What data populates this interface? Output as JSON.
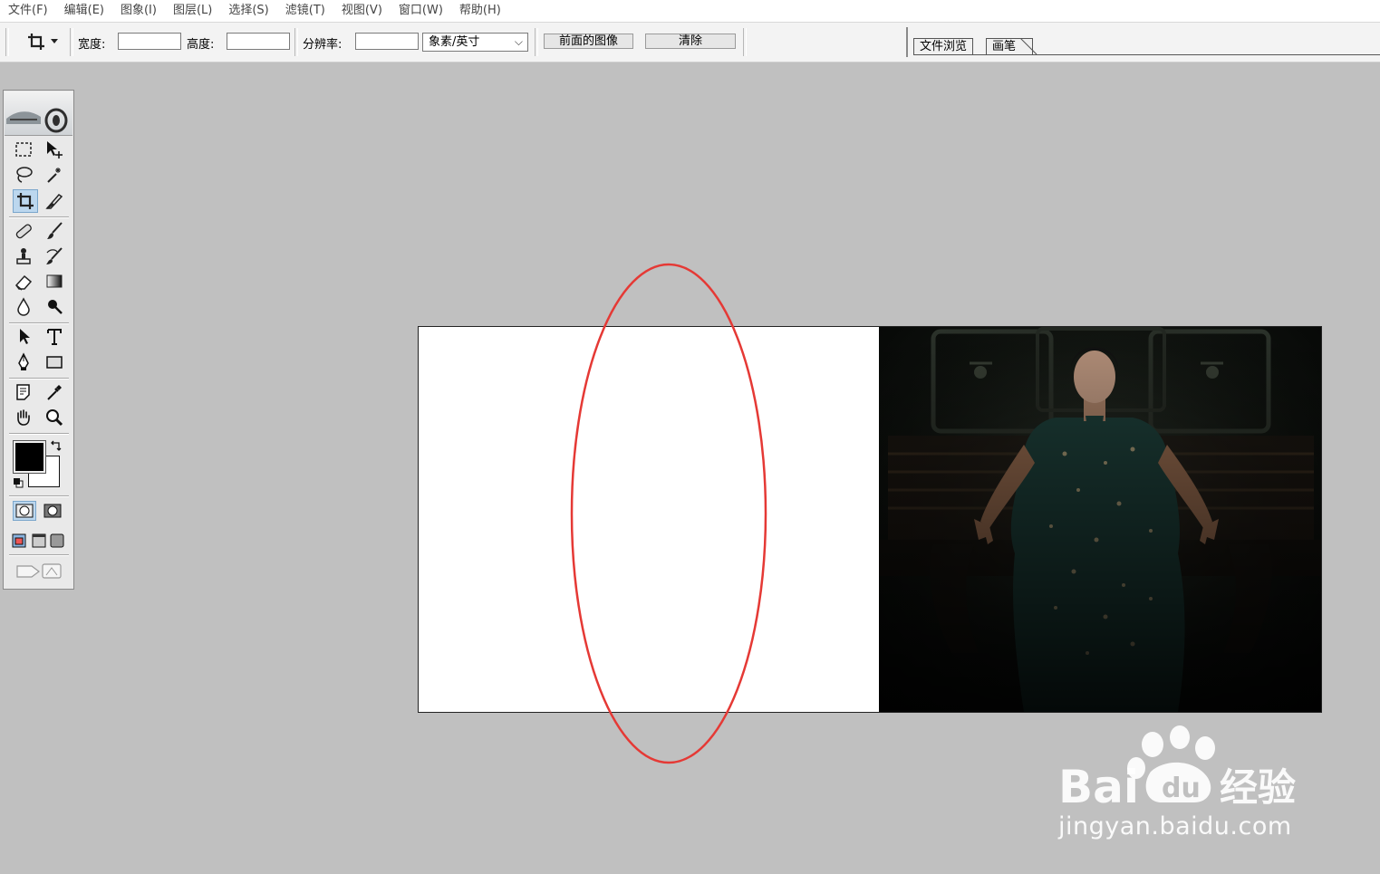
{
  "menu": [
    "文件(F)",
    "编辑(E)",
    "图象(I)",
    "图层(L)",
    "选择(S)",
    "滤镜(T)",
    "视图(V)",
    "窗口(W)",
    "帮助(H)"
  ],
  "options_bar": {
    "tool_icon": "crop-icon",
    "width_label": "宽度:",
    "height_label": "高度:",
    "resolution_label": "分辨率:",
    "width_value": "",
    "height_value": "",
    "resolution_value": "",
    "resolution_unit": "象素/英寸",
    "front_image_button": "前面的图像",
    "clear_button": "清除"
  },
  "palette_well": {
    "tabs": [
      "文件浏览",
      "画笔"
    ]
  },
  "toolbox": {
    "tools": [
      "marquee-icon",
      "move-icon",
      "lasso-icon",
      "magic-wand-icon",
      "crop-icon",
      "slice-icon",
      "healing-brush-icon",
      "brush-icon",
      "clone-stamp-icon",
      "history-brush-icon",
      "eraser-icon",
      "gradient-icon",
      "blur-icon",
      "dodge-icon",
      "path-selection-icon",
      "text-icon",
      "pen-icon",
      "rectangle-icon",
      "notes-icon",
      "eyedropper-icon",
      "hand-icon",
      "zoom-icon"
    ],
    "active_tool": "crop-icon",
    "foreground_color": "#000000",
    "background_color": "#ffffff"
  },
  "document": {
    "left_region_color": "#ffffff",
    "photo_description_tone": "dark"
  },
  "annotation": {
    "color": "#e53935",
    "shape": "ellipse"
  },
  "watermark": {
    "brand": "Bai du 经验",
    "url": "jingyan.baidu.com"
  }
}
